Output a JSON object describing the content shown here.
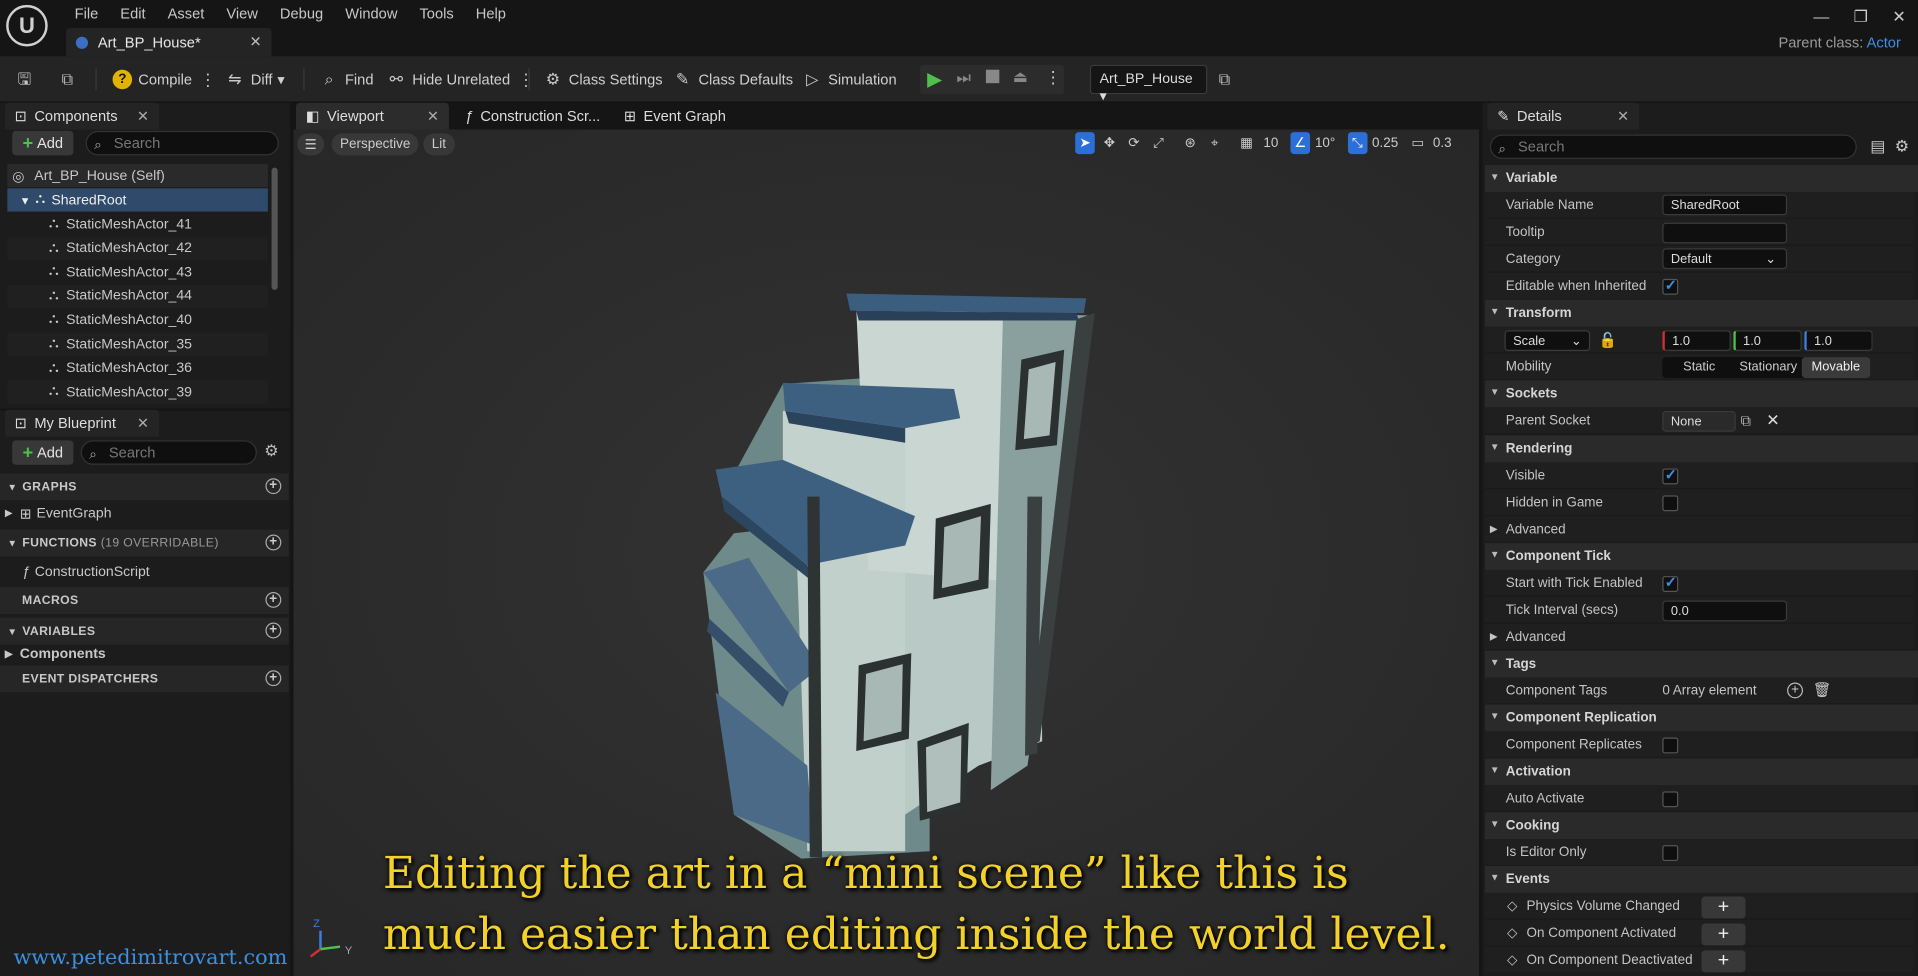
{
  "menubar": {
    "items": [
      "File",
      "Edit",
      "Asset",
      "View",
      "Debug",
      "Window",
      "Tools",
      "Help"
    ],
    "doc_tab": "Art_BP_House*",
    "parent_class_label": "Parent class:",
    "parent_class_value": "Actor"
  },
  "toolbar": {
    "compile": "Compile",
    "diff": "Diff",
    "find": "Find",
    "hide_unrelated": "Hide Unrelated",
    "class_settings": "Class Settings",
    "class_defaults": "Class Defaults",
    "simulation": "Simulation",
    "debug_object": "Art_BP_House"
  },
  "components": {
    "tab": "Components",
    "add": "Add",
    "search_placeholder": "Search",
    "self": "Art_BP_House (Self)",
    "root": "SharedRoot",
    "children": [
      "StaticMeshActor_41",
      "StaticMeshActor_42",
      "StaticMeshActor_43",
      "StaticMeshActor_44",
      "StaticMeshActor_40",
      "StaticMeshActor_35",
      "StaticMeshActor_36",
      "StaticMeshActor_39"
    ]
  },
  "myblueprint": {
    "tab": "My Blueprint",
    "add": "Add",
    "search_placeholder": "Search",
    "graphs": "GRAPHS",
    "event_graph": "EventGraph",
    "functions": "FUNCTIONS",
    "functions_note": "(19 OVERRIDABLE)",
    "construction_script": "ConstructionScript",
    "macros": "MACROS",
    "variables": "VARIABLES",
    "components": "Components",
    "event_dispatchers": "EVENT DISPATCHERS"
  },
  "editor_tabs": {
    "viewport": "Viewport",
    "construction": "Construction Scr...",
    "event_graph": "Event Graph"
  },
  "viewport": {
    "perspective": "Perspective",
    "lit": "Lit",
    "grid": "10",
    "rotation": "10°",
    "scale": "0.25",
    "camera": "0.3",
    "caption_line1": "Editing the art in a “mini scene” like this is",
    "caption_line2": "much easier than editing inside the world level.",
    "watermark": "www.petedimitrovart.com",
    "axis_z": "Z",
    "axis_y": "Y"
  },
  "details": {
    "tab": "Details",
    "search_placeholder": "Search",
    "variable": "Variable",
    "variable_name_label": "Variable Name",
    "variable_name": "SharedRoot",
    "tooltip_label": "Tooltip",
    "category_label": "Category",
    "category": "Default",
    "editable_label": "Editable when Inherited",
    "transform": "Transform",
    "scale_label": "Scale",
    "scale_x": "1.0",
    "scale_y": "1.0",
    "scale_z": "1.0",
    "mobility_label": "Mobility",
    "mobility_static": "Static",
    "mobility_stationary": "Stationary",
    "mobility_movable": "Movable",
    "sockets": "Sockets",
    "parent_socket_label": "Parent Socket",
    "parent_socket": "None",
    "rendering": "Rendering",
    "visible_label": "Visible",
    "hidden_label": "Hidden in Game",
    "advanced": "Advanced",
    "component_tick": "Component Tick",
    "start_tick_label": "Start with Tick Enabled",
    "tick_interval_label": "Tick Interval (secs)",
    "tick_interval": "0.0",
    "advanced2": "Advanced",
    "tags": "Tags",
    "component_tags_label": "Component Tags",
    "component_tags": "0 Array element",
    "replication": "Component Replication",
    "replicates_label": "Component Replicates",
    "activation": "Activation",
    "auto_activate_label": "Auto Activate",
    "cooking": "Cooking",
    "editor_only_label": "Is Editor Only",
    "events": "Events",
    "event1": "Physics Volume Changed",
    "event2": "On Component Activated",
    "event3": "On Component Deactivated"
  },
  "colors": {
    "accent": "#3d8fe0",
    "caption": "#f1d12a",
    "play": "#4ec04e"
  }
}
